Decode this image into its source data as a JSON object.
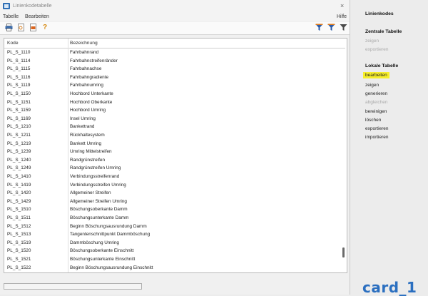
{
  "window": {
    "title": "Linienkodetabelle",
    "close_glyph": "×"
  },
  "menubar": {
    "items": [
      "Tabelle",
      "Bearbeiten"
    ],
    "help": "Hilfe"
  },
  "toolbar": {
    "left_icons": [
      "print-icon",
      "preview-icon",
      "export-icon",
      "help-icon"
    ],
    "right_icons": [
      "filter-icon",
      "filter-add-icon",
      "filter-clear-icon"
    ]
  },
  "table": {
    "columns": [
      "Kode",
      "Bezeichnung"
    ],
    "rows": [
      [
        "PL_S_1110",
        "Fahrbahnrand"
      ],
      [
        "PL_S_1114",
        "Fahrbahnstreifenränder"
      ],
      [
        "PL_S_1115",
        "Fahrbahnachse"
      ],
      [
        "PL_S_1116",
        "Fahrbahngradiente"
      ],
      [
        "PL_S_1119",
        "Fahrbahnumring"
      ],
      [
        "PL_S_1150",
        "Hochbord Unterkante"
      ],
      [
        "PL_S_1151",
        "Hochbord Oberkante"
      ],
      [
        "PL_S_1159",
        "Hochbord Umring"
      ],
      [
        "PL_S_1169",
        "Insel Umring"
      ],
      [
        "PL_S_1210",
        "Bankettrand"
      ],
      [
        "PL_S_1211",
        "Rückhaltesystem"
      ],
      [
        "PL_S_1219",
        "Bankett Umring"
      ],
      [
        "PL_S_1239",
        "Umring Mittelstreifen"
      ],
      [
        "PL_S_1240",
        "Randgrünstreifen"
      ],
      [
        "PL_S_1249",
        "Randgrünstreifen Umring"
      ],
      [
        "PL_S_1410",
        "Verbindungsstreifenrand"
      ],
      [
        "PL_S_1419",
        "Verbindungsstreifen Umring"
      ],
      [
        "PL_S_1420",
        "Allgemeiner Streifen"
      ],
      [
        "PL_S_1429",
        "Allgemeiner Streifen Umring"
      ],
      [
        "PL_S_1510",
        "Böschungsoberkante Damm"
      ],
      [
        "PL_S_1511",
        "Böschungsunterkante Damm"
      ],
      [
        "PL_S_1512",
        "Beginn Böschungsausrundung Damm"
      ],
      [
        "PL_S_1513",
        "Tangentenschnittpunkt Dammböschung"
      ],
      [
        "PL_S_1519",
        "Dammböschung Umring"
      ],
      [
        "PL_S_1520",
        "Böschungsoberkante Einschnitt"
      ],
      [
        "PL_S_1521",
        "Böschungsunterkante Einschnitt"
      ],
      [
        "PL_S_1522",
        "Beginn Böschungsausrundung Einschnitt"
      ]
    ]
  },
  "sidebar": {
    "title": "Linienkodes",
    "sections": [
      {
        "heading": "Zentrale Tabelle",
        "items": [
          {
            "label": "zeigen",
            "enabled": false
          },
          {
            "label": "exportieren",
            "enabled": false
          }
        ]
      },
      {
        "heading": "Lokale Tabelle",
        "items": [
          {
            "label": "bearbeiten",
            "enabled": true,
            "highlighted": true
          },
          {
            "label": "zeigen",
            "enabled": true
          },
          {
            "label": "generieren",
            "enabled": true
          },
          {
            "label": "abgleichen",
            "enabled": false
          },
          {
            "label": "bereinigen",
            "enabled": true
          },
          {
            "label": "löschen",
            "enabled": true
          },
          {
            "label": "exportieren",
            "enabled": true
          },
          {
            "label": "importieren",
            "enabled": true
          }
        ]
      }
    ],
    "logo": "card_1"
  },
  "colors": {
    "highlight": "#f7ef2a",
    "logo": "#2b6fc0",
    "app_icon": "#2f6fb5"
  }
}
